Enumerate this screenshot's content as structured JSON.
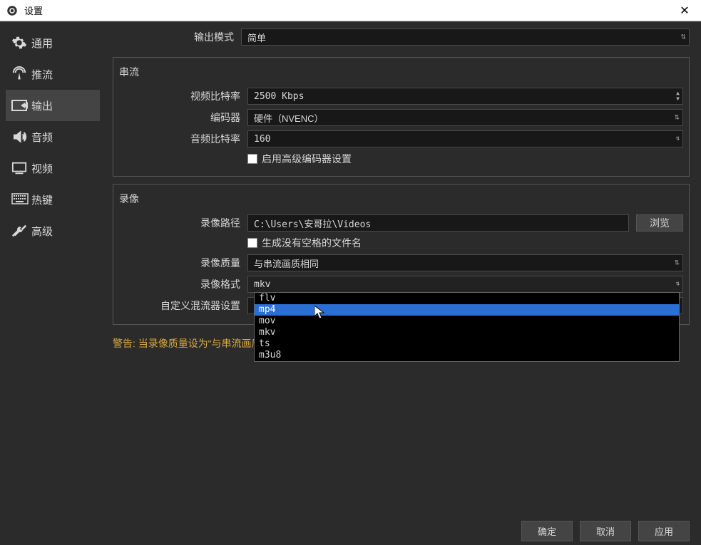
{
  "titlebar": {
    "title": "设置"
  },
  "sidebar": {
    "items": [
      {
        "label": "通用"
      },
      {
        "label": "推流"
      },
      {
        "label": "输出"
      },
      {
        "label": "音频"
      },
      {
        "label": "视频"
      },
      {
        "label": "热键"
      },
      {
        "label": "高级"
      }
    ]
  },
  "output_mode": {
    "label": "输出模式",
    "value": "简单"
  },
  "stream": {
    "title": "串流",
    "video_bitrate": {
      "label": "视频比特率",
      "value": "2500 Kbps"
    },
    "encoder": {
      "label": "编码器",
      "value": "硬件（NVENC）"
    },
    "audio_bitrate": {
      "label": "音频比特率",
      "value": "160"
    },
    "advanced_encoder": {
      "label": "启用高级编码器设置"
    }
  },
  "recording": {
    "title": "录像",
    "path": {
      "label": "录像路径",
      "value": "C:\\Users\\安哥拉\\Videos",
      "browse": "浏览"
    },
    "no_space": {
      "label": "生成没有空格的文件名"
    },
    "quality": {
      "label": "录像质量",
      "value": "与串流画质相同"
    },
    "format": {
      "label": "录像格式",
      "value": "mkv",
      "options": [
        "flv",
        "mp4",
        "mov",
        "mkv",
        "ts",
        "m3u8"
      ],
      "highlighted": "mp4"
    },
    "muxer": {
      "label": "自定义混流器设置"
    }
  },
  "warning": "警告:  当录像质量设为“与串流画质相同”时，无法暂停录制。",
  "footer": {
    "ok": "确定",
    "cancel": "取消",
    "apply": "应用"
  }
}
